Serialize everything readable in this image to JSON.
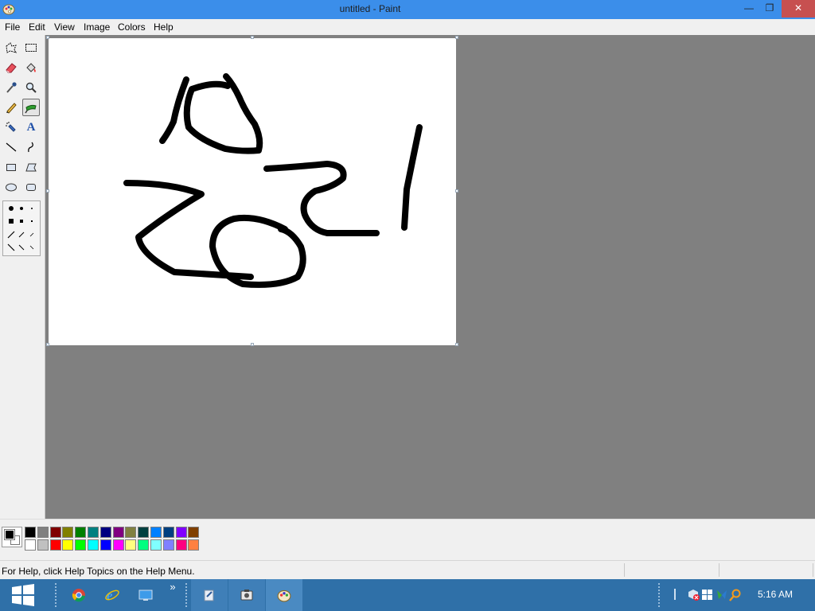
{
  "window": {
    "title": "untitled - Paint",
    "minimize_glyph": "—",
    "maximize_glyph": "❐",
    "close_glyph": "✕"
  },
  "menu": [
    "File",
    "Edit",
    "View",
    "Image",
    "Colors",
    "Help"
  ],
  "tools": [
    {
      "name": "free-form-select-icon"
    },
    {
      "name": "select-icon"
    },
    {
      "name": "eraser-icon"
    },
    {
      "name": "fill-with-color-icon"
    },
    {
      "name": "pick-color-icon"
    },
    {
      "name": "magnifier-icon"
    },
    {
      "name": "pencil-icon"
    },
    {
      "name": "brush-icon",
      "selected": true
    },
    {
      "name": "airbrush-icon"
    },
    {
      "name": "text-icon",
      "glyph": "A"
    },
    {
      "name": "line-icon"
    },
    {
      "name": "curve-icon"
    },
    {
      "name": "rectangle-icon"
    },
    {
      "name": "polygon-icon"
    },
    {
      "name": "ellipse-icon"
    },
    {
      "name": "rounded-rectangle-icon"
    }
  ],
  "colors": {
    "foreground": "#000000",
    "background": "#ffffff",
    "palette_top": [
      "#000000",
      "#808080",
      "#800000",
      "#808000",
      "#008000",
      "#008080",
      "#000080",
      "#800080",
      "#808040",
      "#004040",
      "#0080ff",
      "#004080",
      "#8000ff",
      "#804000"
    ],
    "palette_bottom": [
      "#ffffff",
      "#c0c0c0",
      "#ff0000",
      "#ffff00",
      "#00ff00",
      "#00ffff",
      "#0000ff",
      "#ff00ff",
      "#ffff80",
      "#00ff80",
      "#80ffff",
      "#8080ff",
      "#ff0080",
      "#ff8040"
    ]
  },
  "status": {
    "help_text": "For Help, click Help Topics on the Help Menu."
  },
  "taskbar": {
    "items": [
      "start-button",
      "chrome-icon",
      "internet-explorer-icon",
      "desktop-icon",
      "show-more-icon",
      "app-icon",
      "camera-app-icon",
      "paint-app-icon"
    ],
    "overflow_glyph": "»",
    "clock": "5:16 AM"
  }
}
